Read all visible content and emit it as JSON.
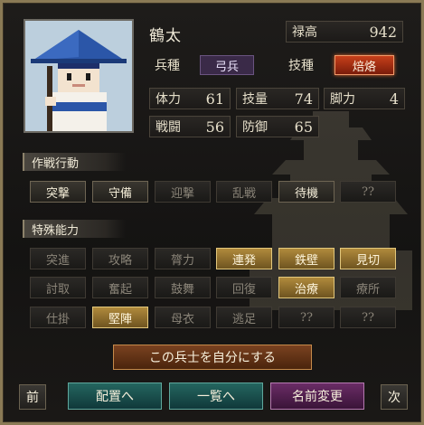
{
  "unit": {
    "name": "鶴太"
  },
  "salary": {
    "label": "禄高",
    "value": "942"
  },
  "troop_type": {
    "label": "兵種",
    "value": "弓兵"
  },
  "tech": {
    "label": "技種",
    "value": "焙烙"
  },
  "stats": [
    {
      "label": "体力",
      "value": "61"
    },
    {
      "label": "技量",
      "value": "74"
    },
    {
      "label": "脚力",
      "value": "4"
    },
    {
      "label": "戦闘",
      "value": "56"
    },
    {
      "label": "防御",
      "value": "65"
    }
  ],
  "tactics": {
    "heading": "作戦行動",
    "items": [
      {
        "label": "突撃",
        "state": "on"
      },
      {
        "label": "守備",
        "state": "on"
      },
      {
        "label": "迎撃",
        "state": "off"
      },
      {
        "label": "乱戦",
        "state": "off"
      },
      {
        "label": "待機",
        "state": "on"
      },
      {
        "label": "??",
        "state": "off"
      }
    ]
  },
  "abilities": {
    "heading": "特殊能力",
    "items": [
      {
        "label": "突進",
        "state": "off"
      },
      {
        "label": "攻略",
        "state": "off"
      },
      {
        "label": "膂力",
        "state": "off"
      },
      {
        "label": "連発",
        "state": "gold"
      },
      {
        "label": "鉄壁",
        "state": "gold"
      },
      {
        "label": "見切",
        "state": "gold"
      },
      {
        "label": "討取",
        "state": "off"
      },
      {
        "label": "奮起",
        "state": "off"
      },
      {
        "label": "鼓舞",
        "state": "off"
      },
      {
        "label": "回復",
        "state": "off"
      },
      {
        "label": "治療",
        "state": "gold"
      },
      {
        "label": "療所",
        "state": "off"
      },
      {
        "label": "仕掛",
        "state": "off"
      },
      {
        "label": "堅陣",
        "state": "gold"
      },
      {
        "label": "母衣",
        "state": "off"
      },
      {
        "label": "逃足",
        "state": "off"
      },
      {
        "label": "??",
        "state": "off"
      },
      {
        "label": "??",
        "state": "off"
      }
    ]
  },
  "actions": {
    "make_own": "この兵士を自分にする",
    "prev": "前",
    "next": "次",
    "deploy": "配置へ",
    "list": "一覧へ",
    "rename": "名前変更"
  },
  "colors": {
    "gold": "#b08a3c",
    "fire": "#c8401a",
    "teal": "#1f5a55",
    "purple": "#5a2a56",
    "bronze": "#6a3a1c"
  }
}
